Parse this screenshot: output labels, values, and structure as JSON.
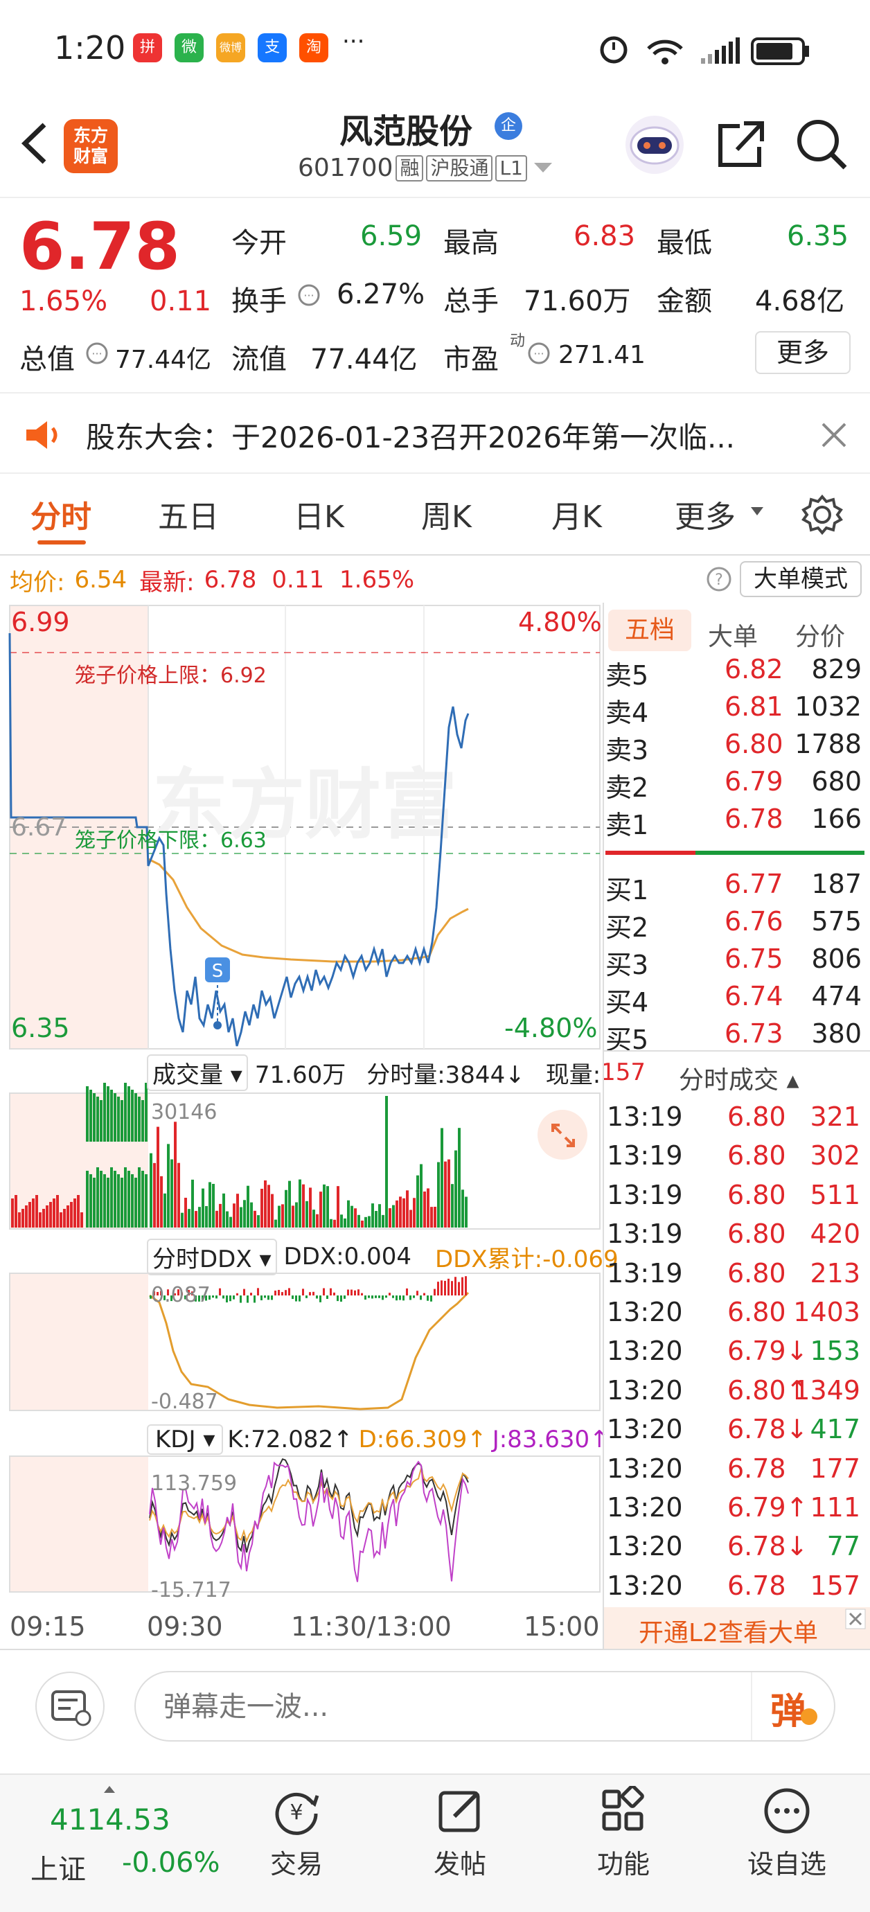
{
  "status_bar": {
    "time": "1:20",
    "more": "···",
    "apps": [
      "拼",
      "微",
      "微博",
      "支",
      "淘"
    ]
  },
  "header": {
    "title": "风范股份",
    "badge": "企",
    "code": "601700",
    "tags": [
      "融",
      "沪股通",
      "L1"
    ]
  },
  "quote": {
    "price": "6.78",
    "change_pct": "1.65%",
    "change": "0.11",
    "open_label": "今开",
    "open": "6.59",
    "high_label": "最高",
    "high": "6.83",
    "low_label": "最低",
    "low": "6.35",
    "turnover_label": "换手",
    "turnover": "6.27%",
    "volume_label": "总手",
    "volume": "71.60万",
    "amount_label": "金额",
    "amount": "4.68亿",
    "mktcap_label": "总值",
    "mktcap": "77.44亿",
    "float_label": "流值",
    "float": "77.44亿",
    "pe_label": "市盈",
    "pe_sup": "动",
    "pe": "271.41",
    "more": "更多"
  },
  "notice": {
    "text": "股东大会：于2026-01-23召开2026年第一次临..."
  },
  "tabs": [
    "分时",
    "五日",
    "日K",
    "周K",
    "月K",
    "更多"
  ],
  "info_line": {
    "avg_label": "均价:",
    "avg": "6.54",
    "latest_label": "最新:",
    "latest": "6.78",
    "chg": "0.11",
    "pct": "1.65%",
    "mode": "大单模式"
  },
  "chart": {
    "ymax": "6.99",
    "ymin": "6.35",
    "ymid": "6.67",
    "pmax": "4.80%",
    "pmin": "-4.80%",
    "upper_limit": "笼子价格上限：6.92",
    "lower_limit": "笼子价格下限：6.63",
    "watermark": "东方财富",
    "s_marker": "S",
    "vol_label": "成交量",
    "vol_total": "71.60万",
    "vol_tick": "分时量:3844↓",
    "vol_now_label": "现量:",
    "vol_now": "157",
    "vol_max": "30146",
    "ddx_label": "分时DDX",
    "ddx": "DDX:0.004",
    "ddx_cum": "DDX累计:-0.069",
    "ddx_top": "0.087",
    "ddx_bot": "-0.487",
    "kdj_label": "KDJ",
    "k": "K:72.082↑",
    "d": "D:66.309↑",
    "j": "J:83.630↑",
    "kdj_top": "113.759",
    "kdj_bot": "-15.717",
    "times": [
      "09:15",
      "09:30",
      "11:30/13:00",
      "15:00"
    ]
  },
  "order_book": {
    "tabs": [
      "五档",
      "大单",
      "分价"
    ],
    "asks": [
      {
        "l": "卖5",
        "p": "6.82",
        "v": "829"
      },
      {
        "l": "卖4",
        "p": "6.81",
        "v": "1032"
      },
      {
        "l": "卖3",
        "p": "6.80",
        "v": "1788"
      },
      {
        "l": "卖2",
        "p": "6.79",
        "v": "680"
      },
      {
        "l": "卖1",
        "p": "6.78",
        "v": "166"
      }
    ],
    "bids": [
      {
        "l": "买1",
        "p": "6.77",
        "v": "187"
      },
      {
        "l": "买2",
        "p": "6.76",
        "v": "575"
      },
      {
        "l": "买3",
        "p": "6.75",
        "v": "806"
      },
      {
        "l": "买4",
        "p": "6.74",
        "v": "474"
      },
      {
        "l": "买5",
        "p": "6.73",
        "v": "380"
      }
    ]
  },
  "ticks": {
    "title": "分时成交",
    "rows": [
      {
        "t": "13:19",
        "p": "6.80",
        "v": "321"
      },
      {
        "t": "13:19",
        "p": "6.80",
        "v": "302"
      },
      {
        "t": "13:19",
        "p": "6.80",
        "v": "511"
      },
      {
        "t": "13:19",
        "p": "6.80",
        "v": "420"
      },
      {
        "t": "13:19",
        "p": "6.80",
        "v": "213"
      },
      {
        "t": "13:20",
        "p": "6.80",
        "v": "1403"
      },
      {
        "t": "13:20",
        "p": "6.79↓",
        "v": "153"
      },
      {
        "t": "13:20",
        "p": "6.80↑",
        "v": "1349"
      },
      {
        "t": "13:20",
        "p": "6.78↓",
        "v": "417"
      },
      {
        "t": "13:20",
        "p": "6.78",
        "v": "177"
      },
      {
        "t": "13:20",
        "p": "6.79↑",
        "v": "111"
      },
      {
        "t": "13:20",
        "p": "6.78↓",
        "v": "77"
      },
      {
        "t": "13:20",
        "p": "6.78",
        "v": "157"
      }
    ],
    "l2": "开通L2查看大单"
  },
  "comment": {
    "placeholder": "弹幕走一波...",
    "btn": "弹"
  },
  "bottom": {
    "index_val": "4114.53",
    "index_name": "上证",
    "index_chg": "-0.06%",
    "nav": [
      "交易",
      "发帖",
      "功能",
      "设自选"
    ]
  }
}
